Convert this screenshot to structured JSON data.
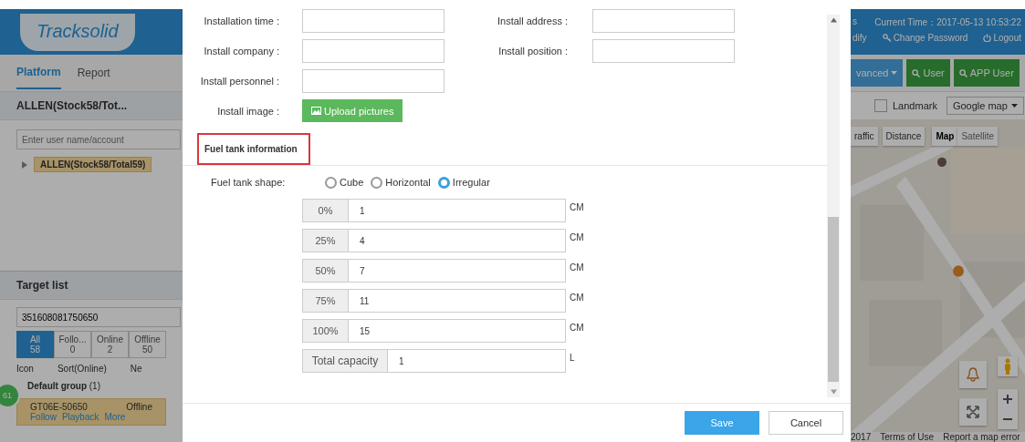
{
  "left_panel": {
    "logo": "Tracksolid",
    "nav": [
      {
        "label": "Platform",
        "selected": true
      },
      {
        "label": "Report",
        "selected": false
      }
    ],
    "account_title": "ALLEN(Stock58/Tot...",
    "user_search": {
      "placeholder": "Enter user name/account"
    },
    "tree": [
      {
        "label": "ALLEN(Stock58/Total59)",
        "expanded": false
      }
    ],
    "target_title": "Target list",
    "target_search": {
      "value": "351608081750650"
    },
    "status_tabs": [
      {
        "label": "All",
        "count": "58",
        "selected": true
      },
      {
        "label": "Follo...",
        "count": "0",
        "selected": false
      },
      {
        "label": "Online",
        "count": "2",
        "selected": false
      },
      {
        "label": "Offline",
        "count": "50",
        "selected": false
      }
    ],
    "toolbar": {
      "icon_label": "Icon",
      "sort": "Sort(Online)",
      "new_label": "Ne"
    },
    "badge": "61",
    "group": {
      "name": "Default group",
      "count": "(1)"
    },
    "device": {
      "name": "GT06E-50650",
      "status": "Offline",
      "actions": [
        "Follow",
        "Playback",
        "More"
      ]
    }
  },
  "dialog": {
    "fields": [
      {
        "label": "Installation time :",
        "label2": "Install address :"
      },
      {
        "label": "Install company :",
        "label2": "Install position :"
      },
      {
        "label": "Install personnel :"
      }
    ],
    "image_label": "Install image :",
    "upload_button": "Upload pictures",
    "section_title": "Fuel tank information",
    "shape_label": "Fuel tank shape:",
    "shapes": [
      {
        "label": "Cube",
        "selected": false
      },
      {
        "label": "Horizontal",
        "selected": false
      },
      {
        "label": "Irregular",
        "selected": true
      }
    ],
    "levels": [
      {
        "label": "0%",
        "value": "1",
        "unit": "CM"
      },
      {
        "label": "25%",
        "value": "4",
        "unit": "CM"
      },
      {
        "label": "50%",
        "value": "7",
        "unit": "CM"
      },
      {
        "label": "75%",
        "value": "11",
        "unit": "CM"
      },
      {
        "label": "100%",
        "value": "15",
        "unit": "CM"
      },
      {
        "label": "Total capacity",
        "value": "1",
        "unit": "L"
      }
    ],
    "buttons": [
      {
        "label": "Save",
        "kind": "primary"
      },
      {
        "label": "Cancel",
        "kind": "default"
      }
    ]
  },
  "right_panel": {
    "cut_text": "s",
    "current_time": "Current Time：2017-05-13 10:53:22",
    "links": [
      "dify",
      "Change Password",
      "Logout"
    ],
    "buttons": [
      {
        "label": "vanced",
        "kind": "dropdown"
      },
      {
        "label": "User",
        "kind": "search"
      },
      {
        "label": "APP User",
        "kind": "search"
      }
    ],
    "landmark": {
      "label": "Landmark",
      "checked": false
    },
    "map_select": "Google map",
    "map_tools": [
      "raffic",
      "Distance"
    ],
    "map_types": [
      {
        "label": "Map",
        "selected": true
      },
      {
        "label": "Satellite",
        "selected": false
      }
    ],
    "footer": [
      "2017",
      "Terms of Use",
      "Report a map error"
    ]
  }
}
